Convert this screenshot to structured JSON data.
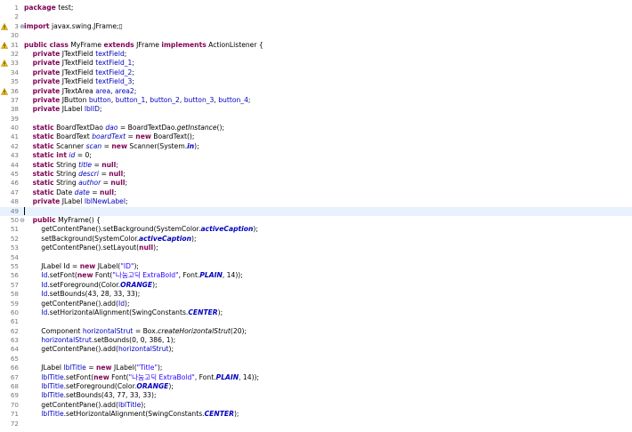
{
  "editor": {
    "lines": [
      {
        "n": "1",
        "tokens": [
          {
            "t": "package",
            "c": "kw"
          },
          {
            "t": " test;"
          }
        ]
      },
      {
        "n": "2",
        "tokens": []
      },
      {
        "n": "3",
        "fold": "+",
        "tokens": [
          {
            "t": "import",
            "c": "kw"
          },
          {
            "t": " javax.swing.JFrame;"
          },
          {
            "t": "▯",
            "c": "ph"
          }
        ]
      },
      {
        "n": "30",
        "tokens": []
      },
      {
        "n": "31",
        "tokens": [
          {
            "t": "public class",
            "c": "kw"
          },
          {
            "t": " MyFrame "
          },
          {
            "t": "extends",
            "c": "kw"
          },
          {
            "t": " JFrame "
          },
          {
            "t": "implements",
            "c": "kw"
          },
          {
            "t": " ActionListener {"
          }
        ]
      },
      {
        "n": "32",
        "tokens": [
          {
            "t": "    "
          },
          {
            "t": "private",
            "c": "kw"
          },
          {
            "t": " JTextField "
          },
          {
            "t": "textField",
            "c": "fld"
          },
          {
            "t": ";"
          }
        ]
      },
      {
        "n": "33",
        "tokens": [
          {
            "t": "    "
          },
          {
            "t": "private",
            "c": "kw"
          },
          {
            "t": " JTextField "
          },
          {
            "t": "textField_1",
            "c": "fld"
          },
          {
            "t": ";"
          }
        ]
      },
      {
        "n": "34",
        "tokens": [
          {
            "t": "    "
          },
          {
            "t": "private",
            "c": "kw"
          },
          {
            "t": " JTextField "
          },
          {
            "t": "textField_2",
            "c": "fld"
          },
          {
            "t": ";"
          }
        ]
      },
      {
        "n": "35",
        "tokens": [
          {
            "t": "    "
          },
          {
            "t": "private",
            "c": "kw"
          },
          {
            "t": " JTextField "
          },
          {
            "t": "textField_3",
            "c": "fld"
          },
          {
            "t": ";"
          }
        ]
      },
      {
        "n": "36",
        "tokens": [
          {
            "t": "    "
          },
          {
            "t": "private",
            "c": "kw"
          },
          {
            "t": " JTextArea "
          },
          {
            "t": "area",
            "c": "fld"
          },
          {
            "t": ", "
          },
          {
            "t": "area2",
            "c": "fld"
          },
          {
            "t": ";"
          }
        ]
      },
      {
        "n": "37",
        "tokens": [
          {
            "t": "    "
          },
          {
            "t": "private",
            "c": "kw"
          },
          {
            "t": " JButton "
          },
          {
            "t": "button",
            "c": "fld"
          },
          {
            "t": ", "
          },
          {
            "t": "button_1",
            "c": "fld"
          },
          {
            "t": ", "
          },
          {
            "t": "button_2",
            "c": "fld"
          },
          {
            "t": ", "
          },
          {
            "t": "button_3",
            "c": "fld"
          },
          {
            "t": ", "
          },
          {
            "t": "button_4",
            "c": "fld"
          },
          {
            "t": ";"
          }
        ]
      },
      {
        "n": "38",
        "tokens": [
          {
            "t": "    "
          },
          {
            "t": "private",
            "c": "kw"
          },
          {
            "t": " JLabel "
          },
          {
            "t": "lblID",
            "c": "fld"
          },
          {
            "t": ";"
          }
        ]
      },
      {
        "n": "39",
        "tokens": []
      },
      {
        "n": "40",
        "tokens": [
          {
            "t": "    "
          },
          {
            "t": "static",
            "c": "kw"
          },
          {
            "t": " BoardTextDao "
          },
          {
            "t": "dao",
            "c": "sfld"
          },
          {
            "t": " = BoardTextDao."
          },
          {
            "t": "getInstance",
            "c": "smeth"
          },
          {
            "t": "();"
          }
        ]
      },
      {
        "n": "41",
        "tokens": [
          {
            "t": "    "
          },
          {
            "t": "static",
            "c": "kw"
          },
          {
            "t": " BoardText "
          },
          {
            "t": "boardText",
            "c": "sfld"
          },
          {
            "t": " = "
          },
          {
            "t": "new",
            "c": "kw"
          },
          {
            "t": " BoardText();"
          }
        ]
      },
      {
        "n": "42",
        "tokens": [
          {
            "t": "    "
          },
          {
            "t": "static",
            "c": "kw"
          },
          {
            "t": " Scanner "
          },
          {
            "t": "scan",
            "c": "sfld"
          },
          {
            "t": " = "
          },
          {
            "t": "new",
            "c": "kw"
          },
          {
            "t": " Scanner(System."
          },
          {
            "t": "in",
            "c": "sconst"
          },
          {
            "t": ");"
          }
        ]
      },
      {
        "n": "43",
        "tokens": [
          {
            "t": "    "
          },
          {
            "t": "static int",
            "c": "kw"
          },
          {
            "t": " "
          },
          {
            "t": "id",
            "c": "sfld"
          },
          {
            "t": " = 0;"
          }
        ]
      },
      {
        "n": "44",
        "tokens": [
          {
            "t": "    "
          },
          {
            "t": "static",
            "c": "kw"
          },
          {
            "t": " String "
          },
          {
            "t": "title",
            "c": "sfld"
          },
          {
            "t": " = "
          },
          {
            "t": "null",
            "c": "kw"
          },
          {
            "t": ";"
          }
        ]
      },
      {
        "n": "45",
        "tokens": [
          {
            "t": "    "
          },
          {
            "t": "static",
            "c": "kw"
          },
          {
            "t": " String "
          },
          {
            "t": "descri",
            "c": "sfld"
          },
          {
            "t": " = "
          },
          {
            "t": "null",
            "c": "kw"
          },
          {
            "t": ";"
          }
        ]
      },
      {
        "n": "46",
        "tokens": [
          {
            "t": "    "
          },
          {
            "t": "static",
            "c": "kw"
          },
          {
            "t": " String "
          },
          {
            "t": "author",
            "c": "sfld"
          },
          {
            "t": " = "
          },
          {
            "t": "null",
            "c": "kw"
          },
          {
            "t": ";"
          }
        ]
      },
      {
        "n": "47",
        "tokens": [
          {
            "t": "    "
          },
          {
            "t": "static",
            "c": "kw"
          },
          {
            "t": " Date "
          },
          {
            "t": "date",
            "c": "sfld"
          },
          {
            "t": " = "
          },
          {
            "t": "null",
            "c": "kw"
          },
          {
            "t": ";"
          }
        ]
      },
      {
        "n": "48",
        "tokens": [
          {
            "t": "    "
          },
          {
            "t": "private",
            "c": "kw"
          },
          {
            "t": " JLabel "
          },
          {
            "t": "lblNewLabel",
            "c": "fld"
          },
          {
            "t": ";"
          }
        ]
      },
      {
        "n": "49",
        "current": true,
        "tokens": []
      },
      {
        "n": "50",
        "fold": "-",
        "tokens": [
          {
            "t": "    "
          },
          {
            "t": "public",
            "c": "kw"
          },
          {
            "t": " MyFrame() {"
          }
        ]
      },
      {
        "n": "51",
        "tokens": [
          {
            "t": "        getContentPane().setBackground(SystemColor."
          },
          {
            "t": "activeCaption",
            "c": "sconst"
          },
          {
            "t": ");"
          }
        ]
      },
      {
        "n": "52",
        "tokens": [
          {
            "t": "        setBackground(SystemColor."
          },
          {
            "t": "activeCaption",
            "c": "sconst"
          },
          {
            "t": ");"
          }
        ]
      },
      {
        "n": "53",
        "tokens": [
          {
            "t": "        getContentPane().setLayout("
          },
          {
            "t": "null",
            "c": "kw"
          },
          {
            "t": ");"
          }
        ]
      },
      {
        "n": "54",
        "tokens": []
      },
      {
        "n": "55",
        "tokens": [
          {
            "t": "        JLabel Id = "
          },
          {
            "t": "new",
            "c": "kw"
          },
          {
            "t": " JLabel("
          },
          {
            "t": "\"ID\"",
            "c": "str"
          },
          {
            "t": ");"
          }
        ]
      },
      {
        "n": "56",
        "tokens": [
          {
            "t": "        "
          },
          {
            "t": "Id",
            "c": "fld"
          },
          {
            "t": ".setFont("
          },
          {
            "t": "new",
            "c": "kw"
          },
          {
            "t": " Font("
          },
          {
            "t": "\"나눔고딕 ExtraBold\"",
            "c": "str"
          },
          {
            "t": ", Font."
          },
          {
            "t": "PLAIN",
            "c": "sconst"
          },
          {
            "t": ", 14));"
          }
        ]
      },
      {
        "n": "57",
        "tokens": [
          {
            "t": "        "
          },
          {
            "t": "Id",
            "c": "fld"
          },
          {
            "t": ".setForeground(Color."
          },
          {
            "t": "ORANGE",
            "c": "sconst"
          },
          {
            "t": ");"
          }
        ]
      },
      {
        "n": "58",
        "tokens": [
          {
            "t": "        "
          },
          {
            "t": "Id",
            "c": "fld"
          },
          {
            "t": ".setBounds(43, 28, 33, 33);"
          }
        ]
      },
      {
        "n": "59",
        "tokens": [
          {
            "t": "        getContentPane().add("
          },
          {
            "t": "Id",
            "c": "fld"
          },
          {
            "t": ");"
          }
        ]
      },
      {
        "n": "60",
        "tokens": [
          {
            "t": "        "
          },
          {
            "t": "Id",
            "c": "fld"
          },
          {
            "t": ".setHorizontalAlignment(SwingConstants."
          },
          {
            "t": "CENTER",
            "c": "sconst"
          },
          {
            "t": ");"
          }
        ]
      },
      {
        "n": "61",
        "tokens": []
      },
      {
        "n": "62",
        "tokens": [
          {
            "t": "        Component "
          },
          {
            "t": "horizontalStrut",
            "c": "fld"
          },
          {
            "t": " = Box."
          },
          {
            "t": "createHorizontalStrut",
            "c": "smeth"
          },
          {
            "t": "(20);"
          }
        ]
      },
      {
        "n": "63",
        "tokens": [
          {
            "t": "        "
          },
          {
            "t": "horizontalStrut",
            "c": "fld"
          },
          {
            "t": ".setBounds(0, 0, 386, 1);"
          }
        ]
      },
      {
        "n": "64",
        "tokens": [
          {
            "t": "        getContentPane().add("
          },
          {
            "t": "horizontalStrut",
            "c": "fld"
          },
          {
            "t": ");"
          }
        ]
      },
      {
        "n": "65",
        "tokens": []
      },
      {
        "n": "66",
        "tokens": [
          {
            "t": "        JLabel "
          },
          {
            "t": "lblTitle",
            "c": "fld"
          },
          {
            "t": " = "
          },
          {
            "t": "new",
            "c": "kw"
          },
          {
            "t": " JLabel("
          },
          {
            "t": "\"Title\"",
            "c": "str"
          },
          {
            "t": ");"
          }
        ]
      },
      {
        "n": "67",
        "tokens": [
          {
            "t": "        "
          },
          {
            "t": "lblTitle",
            "c": "fld"
          },
          {
            "t": ".setFont("
          },
          {
            "t": "new",
            "c": "kw"
          },
          {
            "t": " Font("
          },
          {
            "t": "\"나눔고딕 ExtraBold\"",
            "c": "str"
          },
          {
            "t": ", Font."
          },
          {
            "t": "PLAIN",
            "c": "sconst"
          },
          {
            "t": ", 14));"
          }
        ]
      },
      {
        "n": "68",
        "tokens": [
          {
            "t": "        "
          },
          {
            "t": "lblTitle",
            "c": "fld"
          },
          {
            "t": ".setForeground(Color."
          },
          {
            "t": "ORANGE",
            "c": "sconst"
          },
          {
            "t": ");"
          }
        ]
      },
      {
        "n": "69",
        "tokens": [
          {
            "t": "        "
          },
          {
            "t": "lblTitle",
            "c": "fld"
          },
          {
            "t": ".setBounds(43, 77, 33, 33);"
          }
        ]
      },
      {
        "n": "70",
        "tokens": [
          {
            "t": "        getContentPane().add("
          },
          {
            "t": "lblTitle",
            "c": "fld"
          },
          {
            "t": ");"
          }
        ]
      },
      {
        "n": "71",
        "tokens": [
          {
            "t": "        "
          },
          {
            "t": "lblTitle",
            "c": "fld"
          },
          {
            "t": ".setHorizontalAlignment(SwingConstants."
          },
          {
            "t": "CENTER",
            "c": "sconst"
          },
          {
            "t": ");"
          }
        ]
      },
      {
        "n": "72",
        "tokens": []
      }
    ],
    "warning_marker_lines": [
      "3",
      "31",
      "33",
      "36"
    ],
    "colors": {
      "keyword": "#7f0055",
      "field": "#0000c0",
      "string": "#2a00ff",
      "line_number": "#787878",
      "current_line": "#e8f2fe",
      "warning": "#f5c518"
    },
    "icons": {
      "fold_expand": "plus-fold-icon",
      "fold_collapse": "minus-fold-icon",
      "warning": "warning-marker-icon"
    }
  }
}
